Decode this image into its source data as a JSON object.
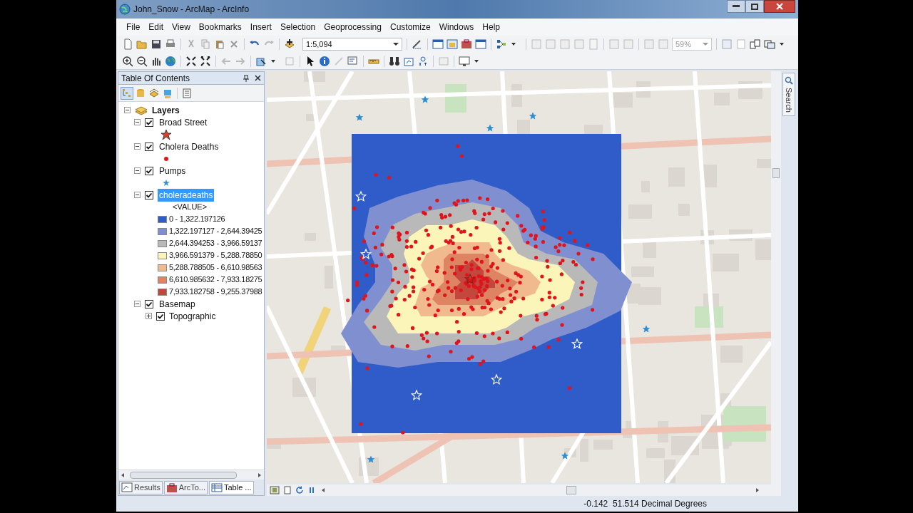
{
  "window": {
    "title": "John_Snow - ArcMap - ArcInfo"
  },
  "menu": [
    "File",
    "Edit",
    "View",
    "Bookmarks",
    "Insert",
    "Selection",
    "Geoprocessing",
    "Customize",
    "Windows",
    "Help"
  ],
  "toolbar": {
    "scale": "1:5,094",
    "zoom": "59%"
  },
  "toc": {
    "title": "Table Of Contents",
    "root": {
      "label": "Layers",
      "expanded": true,
      "children": [
        {
          "label": "Broad Street",
          "checked": true,
          "expanded": true,
          "selected": false,
          "kind": "star"
        },
        {
          "label": "Cholera Deaths",
          "checked": true,
          "expanded": true,
          "selected": false,
          "kind": "dot"
        },
        {
          "label": "Pumps",
          "checked": true,
          "expanded": true,
          "selected": false,
          "kind": "small-star"
        },
        {
          "label": "choleradeaths",
          "checked": true,
          "expanded": true,
          "selected": true,
          "field": "<VALUE>",
          "classes": [
            {
              "label": "0 - 1,322.197126",
              "color": "#2f5cc8"
            },
            {
              "label": "1,322.197127 - 2,644.39425",
              "color": "#7f8fcf"
            },
            {
              "label": "2,644.394253 - 3,966.59137",
              "color": "#b9b9b9"
            },
            {
              "label": "3,966.591379 - 5,288.78850",
              "color": "#fbf5b9"
            },
            {
              "label": "5,288.788505 - 6,610.98563",
              "color": "#f0b98e"
            },
            {
              "label": "6,610.985632 - 7,933.18275",
              "color": "#df8463"
            },
            {
              "label": "7,933.182758 - 9,255.37988",
              "color": "#c4473e"
            }
          ]
        },
        {
          "label": "Basemap",
          "checked": true,
          "expanded": true,
          "selected": false,
          "children": [
            {
              "label": "Topographic",
              "checked": true,
              "expanded": false
            }
          ]
        }
      ]
    }
  },
  "bottom_tabs": [
    {
      "label": "Results",
      "selected": false
    },
    {
      "label": "ArcTo...",
      "selected": false
    },
    {
      "label": "Table ...",
      "selected": true
    }
  ],
  "side_tab": "Search",
  "status_bar": "-0.142  51.514 Decimal Degrees"
}
